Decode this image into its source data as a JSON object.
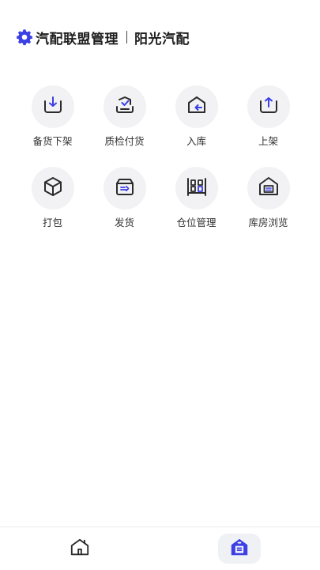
{
  "header": {
    "logo_icon": "gear-icon",
    "app_name": "汽配联盟管理",
    "shop_name": "阳光汽配"
  },
  "colors": {
    "accent": "#3b3fe4",
    "icon_stroke": "#2b2b2b",
    "tile_bg": "#f2f2f4"
  },
  "menu": [
    {
      "label": "备货下架",
      "icon": "tray-down-icon"
    },
    {
      "label": "质检付货",
      "icon": "tray-check-icon"
    },
    {
      "label": "入库",
      "icon": "house-arrow-in-icon"
    },
    {
      "label": "上架",
      "icon": "tray-up-icon"
    },
    {
      "label": "打包",
      "icon": "box-icon"
    },
    {
      "label": "发货",
      "icon": "package-send-icon"
    },
    {
      "label": "仓位管理",
      "icon": "shelf-icon"
    },
    {
      "label": "库房浏览",
      "icon": "warehouse-icon"
    }
  ],
  "bottom_nav": [
    {
      "name": "home",
      "icon": "home-icon",
      "active": false
    },
    {
      "name": "warehouse",
      "icon": "warehouse-filled-icon",
      "active": true
    }
  ]
}
